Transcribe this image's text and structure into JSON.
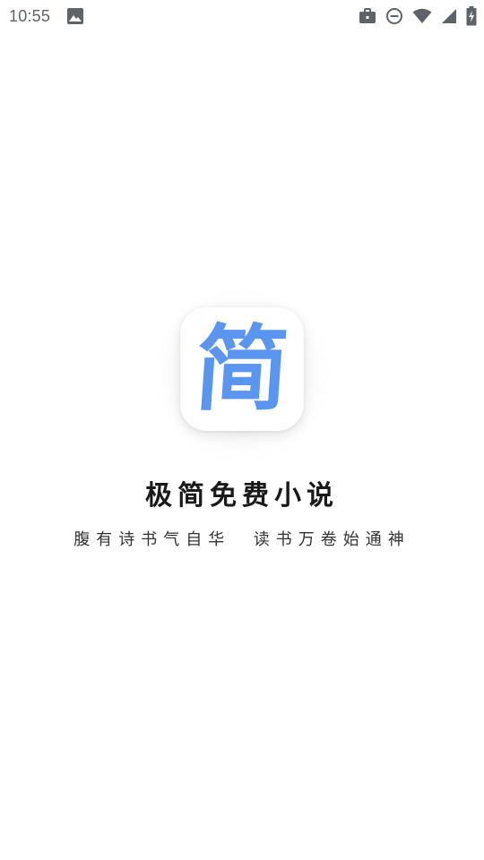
{
  "status_bar": {
    "time": "10:55",
    "icons": [
      "image-icon",
      "briefcase-icon",
      "do-not-disturb-icon",
      "wifi-icon",
      "signal-icon",
      "battery-charging-icon"
    ]
  },
  "splash": {
    "icon_glyph": "简",
    "title": "极简免费小说",
    "slogan": "腹有诗书气自华  读书万卷始通神"
  },
  "colors": {
    "accent": "#5a95f0",
    "title_text": "#1a1a1a",
    "status_icons": "#5f6368"
  }
}
